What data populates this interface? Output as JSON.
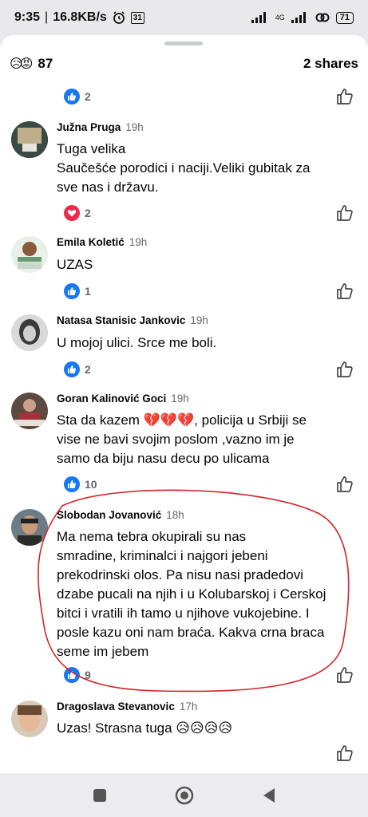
{
  "status": {
    "time": "9:35",
    "speed": "16.8KB/s",
    "calendar": "31",
    "network": "4G",
    "battery": "71"
  },
  "summary": {
    "reaction_icons": [
      "sad-face-icon",
      "angry-face-icon"
    ],
    "count": "87",
    "shares": "2 shares"
  },
  "top_reaction": {
    "icon": "like-icon",
    "count": "2"
  },
  "comments": [
    {
      "name": "Južna Pruga",
      "time": "19h",
      "text": "Tuga velika\nSaučešće porodici i naciji.Veliki gubitak za\nsve nas i državu.",
      "reaction_icon": "heart-icon",
      "reaction_count": "2"
    },
    {
      "name": "Emila Koletić",
      "time": "19h",
      "text": "UZAS",
      "reaction_icon": "like-icon",
      "reaction_count": "1"
    },
    {
      "name": "Natasa Stanisic Jankovic",
      "time": "19h",
      "text": "U mojoj ulici. Srce me boli.",
      "reaction_icon": "like-icon",
      "reaction_count": "2"
    },
    {
      "name": "Goran Kalinović Goci",
      "time": "19h",
      "text": "Sta da kazem 💔💔💔, policija u Srbiji se\nvise ne bavi svojim poslom ,vazno im je\nsamo da biju nasu  decu po ulicama",
      "reaction_icon": "like-icon",
      "reaction_count": "10"
    },
    {
      "name": "Slobodan Jovanović",
      "time": "18h",
      "text": "Ma nema tebra okupirali su nas\n smradine, kriminalci i najgori jebeni\nprekodrinski olos. Pa nisu nasi pradedovi\ndzabe pucali na njih i u Kolubarskoj i Cerskoj\nbitci i vratili ih tamo u njihove vukojebine. I\nposle kazu oni nam braća. Kakva crna braca\nseme im jebem",
      "reaction_icon": "like-icon",
      "reaction_count": "9"
    },
    {
      "name": "Dragoslava Stevanovic",
      "time": "17h",
      "text": "Uzas! Strasna tuga 😥😥😥😥",
      "reaction_icon": "",
      "reaction_count": ""
    }
  ],
  "colors": {
    "like_blue": "#1877f2",
    "heart_red": "#f02849",
    "annotation_red": "#d3252b"
  },
  "navbar": [
    "square-icon",
    "circle-home-icon",
    "back-triangle-icon"
  ]
}
